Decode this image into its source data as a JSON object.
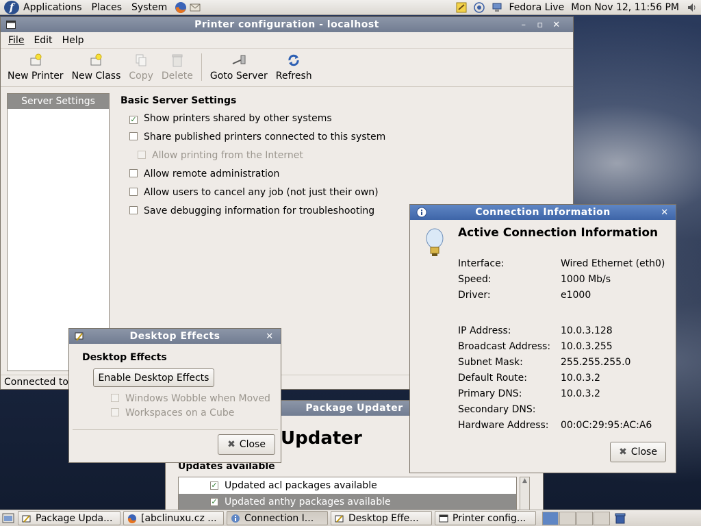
{
  "top_panel": {
    "menus": [
      "Applications",
      "Places",
      "System"
    ],
    "user": "Fedora Live",
    "clock": "Mon Nov 12, 11:56 PM"
  },
  "printer_window": {
    "title": "Printer configuration - localhost",
    "menus": [
      "File",
      "Edit",
      "Help"
    ],
    "toolbar": {
      "new_printer": "New Printer",
      "new_class": "New Class",
      "copy": "Copy",
      "delete": "Delete",
      "goto_server": "Goto Server",
      "refresh": "Refresh"
    },
    "sidebar_item": "Server Settings",
    "section_title": "Basic Server Settings",
    "options": [
      {
        "label": "Show printers shared by other systems",
        "checked": true
      },
      {
        "label": "Share published printers connected to this system",
        "checked": false
      },
      {
        "label": "Allow printing from the Internet",
        "checked": false,
        "disabled": true
      },
      {
        "label": "Allow remote administration",
        "checked": false
      },
      {
        "label": "Allow users to cancel any job (not just their own)",
        "checked": false
      },
      {
        "label": "Save debugging information for troubleshooting",
        "checked": false
      }
    ],
    "status": "Connected to"
  },
  "desktop_effects": {
    "title": "Desktop Effects",
    "heading": "Desktop Effects",
    "enable_button": "Enable Desktop Effects",
    "wobble": "Windows Wobble when Moved",
    "cube": "Workspaces on a Cube",
    "close": "Close"
  },
  "package_updater": {
    "title": "Package Updater",
    "big_title": "Updater",
    "updates_heading": "Updates available",
    "rows": [
      {
        "label": "Updated acl packages available",
        "checked": true
      },
      {
        "label": "Updated anthy packages available",
        "checked": true
      }
    ]
  },
  "connection_info": {
    "title": "Connection Information",
    "heading": "Active Connection Information",
    "fields": [
      {
        "label": "Interface:",
        "value": "Wired Ethernet (eth0)"
      },
      {
        "label": "Speed:",
        "value": "1000 Mb/s"
      },
      {
        "label": "Driver:",
        "value": "e1000"
      },
      {
        "label": "IP Address:",
        "value": "10.0.3.128"
      },
      {
        "label": "Broadcast Address:",
        "value": "10.0.3.255"
      },
      {
        "label": "Subnet Mask:",
        "value": "255.255.255.0"
      },
      {
        "label": "Default Route:",
        "value": "10.0.3.2"
      },
      {
        "label": "Primary DNS:",
        "value": "10.0.3.2"
      },
      {
        "label": "Secondary DNS:",
        "value": ""
      },
      {
        "label": "Hardware Address:",
        "value": "00:0C:29:95:AC:A6"
      }
    ],
    "close": "Close"
  },
  "taskbar": {
    "tasks": [
      {
        "label": "Package Upda..."
      },
      {
        "label": "[abclinuxu.cz ..."
      },
      {
        "label": "Connection I..."
      },
      {
        "label": "Desktop Effe..."
      },
      {
        "label": "Printer config..."
      }
    ]
  },
  "colors": {
    "title_active": "#3e65a8",
    "title_inactive": "#717c91",
    "window_bg": "#efebe7",
    "checkmark": "#2d7a2d"
  }
}
